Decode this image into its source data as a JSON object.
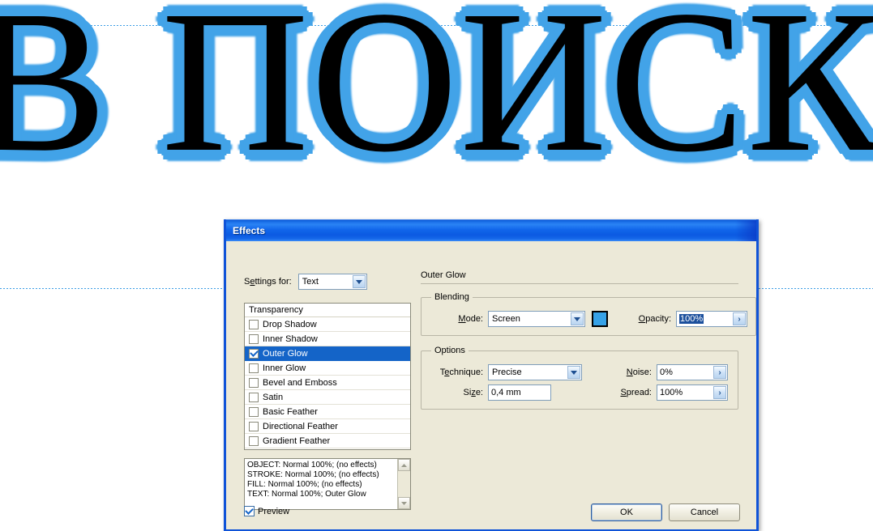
{
  "canvas": {
    "artwork_text": "В ПОИСК",
    "text_color": "#000000",
    "glow_color": "#42a3e8",
    "background": "#ffffff",
    "guide_color": "#3d9ee6"
  },
  "dialog": {
    "title": "Effects",
    "titlebar_color": "#1166ea",
    "face_color": "#ece9d8",
    "settings": {
      "label_pre": "S",
      "label_underlined": "e",
      "label_post": "ttings for:",
      "value": "Text",
      "arrow_icon": "chevron-down-icon"
    },
    "effect_list": {
      "header": "Transparency",
      "items": [
        {
          "label": "Drop Shadow",
          "checked": false,
          "selected": false
        },
        {
          "label": "Inner Shadow",
          "checked": false,
          "selected": false
        },
        {
          "label": "Outer Glow",
          "checked": true,
          "selected": true
        },
        {
          "label": "Inner Glow",
          "checked": false,
          "selected": false
        },
        {
          "label": "Bevel and Emboss",
          "checked": false,
          "selected": false
        },
        {
          "label": "Satin",
          "checked": false,
          "selected": false
        },
        {
          "label": "Basic Feather",
          "checked": false,
          "selected": false
        },
        {
          "label": "Directional Feather",
          "checked": false,
          "selected": false
        },
        {
          "label": "Gradient Feather",
          "checked": false,
          "selected": false
        }
      ],
      "selection_color": "#1464c8"
    },
    "summary": {
      "lines": [
        "OBJECT: Normal 100%; (no effects)",
        "STROKE: Normal 100%; (no effects)",
        "FILL: Normal 100%; (no effects)",
        "TEXT: Normal 100%; Outer Glow"
      ]
    },
    "panel": {
      "title": "Outer Glow",
      "blending": {
        "legend": "Blending",
        "mode_label_pre": "",
        "mode_label_underlined": "M",
        "mode_label_post": "ode:",
        "mode_value": "Screen",
        "swatch_color": "#36a2e8",
        "opacity_label_underlined": "O",
        "opacity_label_post": "pacity:",
        "opacity_value": "100%",
        "opacity_selected": true,
        "spinner_glyph": "›"
      },
      "options": {
        "legend": "Options",
        "technique_label_pre": "T",
        "technique_label_underlined": "e",
        "technique_label_post": "chnique:",
        "technique_value": "Precise",
        "size_label_pre": "Si",
        "size_label_underlined": "z",
        "size_label_post": "e:",
        "size_value": "0,4 mm",
        "noise_label_underlined": "N",
        "noise_label_post": "oise:",
        "noise_value": "0%",
        "spread_label_underlined": "S",
        "spread_label_post": "pread:",
        "spread_value": "100%"
      }
    },
    "footer": {
      "preview_label": "Preview",
      "preview_checked": true,
      "ok_label": "OK",
      "cancel_label": "Cancel"
    }
  }
}
